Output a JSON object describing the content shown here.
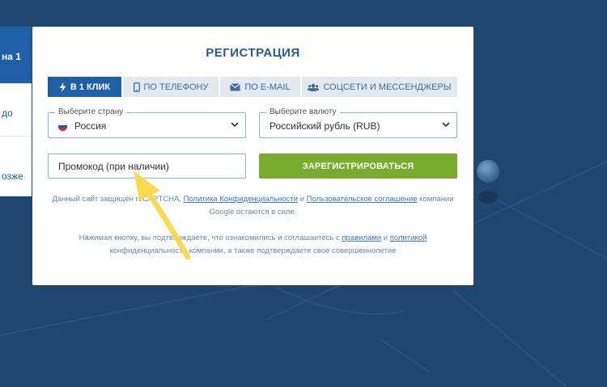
{
  "side_panel": {
    "top_text": "на 1",
    "text_1": "до",
    "text_2": "озже"
  },
  "modal": {
    "title": "РЕГИСТРАЦИЯ",
    "tabs": [
      {
        "label": "В 1 КЛИК",
        "icon": "lightning-icon",
        "active": true
      },
      {
        "label": "ПО ТЕЛЕФОНУ",
        "icon": "phone-icon",
        "active": false
      },
      {
        "label": "ПО E-MAIL",
        "icon": "envelope-icon",
        "active": false
      },
      {
        "label": "СОЦСЕТИ И МЕССЕНДЖЕРЫ",
        "icon": "users-icon",
        "active": false
      }
    ],
    "country": {
      "label": "Выберите страну",
      "value": "Россия"
    },
    "currency": {
      "label": "Выберите валюту",
      "value": "Российский рубль (RUB)"
    },
    "promo": {
      "placeholder": "Промокод (при наличии)"
    },
    "register_button": "ЗАРЕГИСТРИРОВАТЬСЯ",
    "recaptcha": {
      "prefix": "Данный сайт защищён reCAPTCHA, ",
      "privacy_link": "Политика Конфиденциальности",
      "and": " и ",
      "terms_link": "Пользовательское соглашение",
      "suffix_1": " компании",
      "suffix_2": "Google остаются в силе."
    },
    "consent": {
      "prefix": "Нажимая кнопку, вы подтверждаете, что ознакомились и соглашаетесь с ",
      "rules_link": "правилами",
      "and": " и ",
      "policy_link": "политикой",
      "suffix": "конфиденциальности компании, а также подтверждаете свое совершеннолетие"
    }
  },
  "colors": {
    "background": "#1f4670",
    "accent": "#1f5fa8",
    "register_button": "#7aab2e",
    "annotation_arrow": "#f7d94a"
  }
}
